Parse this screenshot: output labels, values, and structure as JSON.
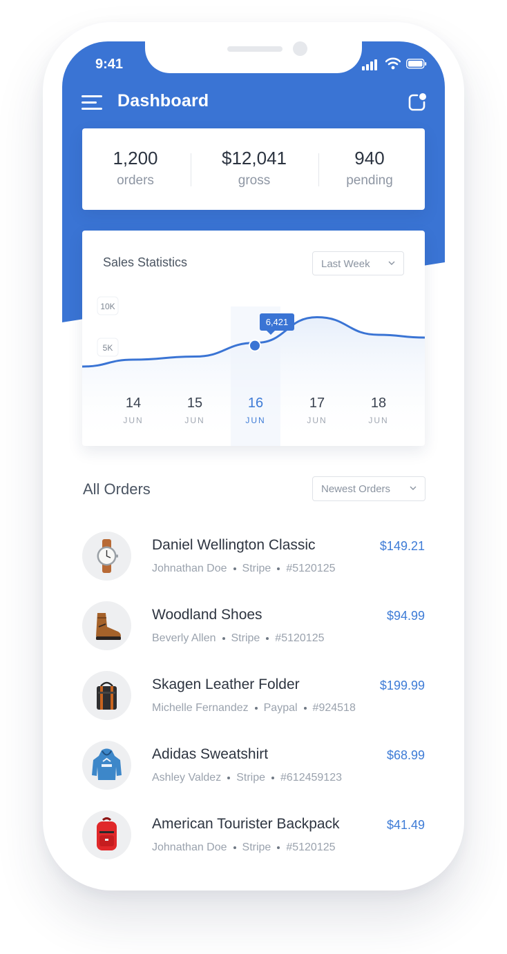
{
  "status": {
    "time": "9:41"
  },
  "header": {
    "title": "Dashboard"
  },
  "summary": [
    {
      "value": "1,200",
      "label": "orders"
    },
    {
      "value": "$12,041",
      "label": "gross"
    },
    {
      "value": "940",
      "label": "pending"
    }
  ],
  "sales": {
    "title": "Sales Statistics",
    "range_select": "Last Week"
  },
  "chart_data": {
    "type": "line",
    "title": "Sales Statistics",
    "x": [
      "14",
      "15",
      "16",
      "17",
      "18"
    ],
    "x_sublabels": [
      "JUN",
      "JUN",
      "JUN",
      "JUN",
      "JUN"
    ],
    "y_ticks": [
      "10K",
      "5K"
    ],
    "series": [
      {
        "values": [
          4800,
          5100,
          6421,
          8900,
          7200
        ]
      }
    ],
    "highlight": {
      "x": "16",
      "value": "6,421"
    },
    "colors": {
      "line": "#3a74d4",
      "highlight": "#3a74d4",
      "active_label": "#3d7bd6"
    }
  },
  "orders": {
    "title": "All Orders",
    "sort_select": "Newest Orders",
    "items": [
      {
        "name": "Daniel Wellington Classic",
        "customer": "Johnathan Doe",
        "method": "Stripe",
        "id": "#5120125",
        "price": "$149.21",
        "icon": "watch-icon"
      },
      {
        "name": "Woodland Shoes",
        "customer": "Beverly Allen",
        "method": "Stripe",
        "id": "#5120125",
        "price": "$94.99",
        "icon": "boot-icon"
      },
      {
        "name": "Skagen Leather Folder",
        "customer": "Michelle Fernandez",
        "method": "Paypal",
        "id": "#924518",
        "price": "$199.99",
        "icon": "bag-icon"
      },
      {
        "name": "Adidas Sweatshirt",
        "customer": "Ashley Valdez",
        "method": "Stripe",
        "id": "#612459123",
        "price": "$68.99",
        "icon": "hoodie-icon"
      },
      {
        "name": "American Tourister Backpack",
        "customer": "Johnathan Doe",
        "method": "Stripe",
        "id": "#5120125",
        "price": "$41.49",
        "icon": "backpack-icon"
      }
    ]
  },
  "colors": {
    "brand": "#3a74d4",
    "price": "#3d7bd6"
  }
}
